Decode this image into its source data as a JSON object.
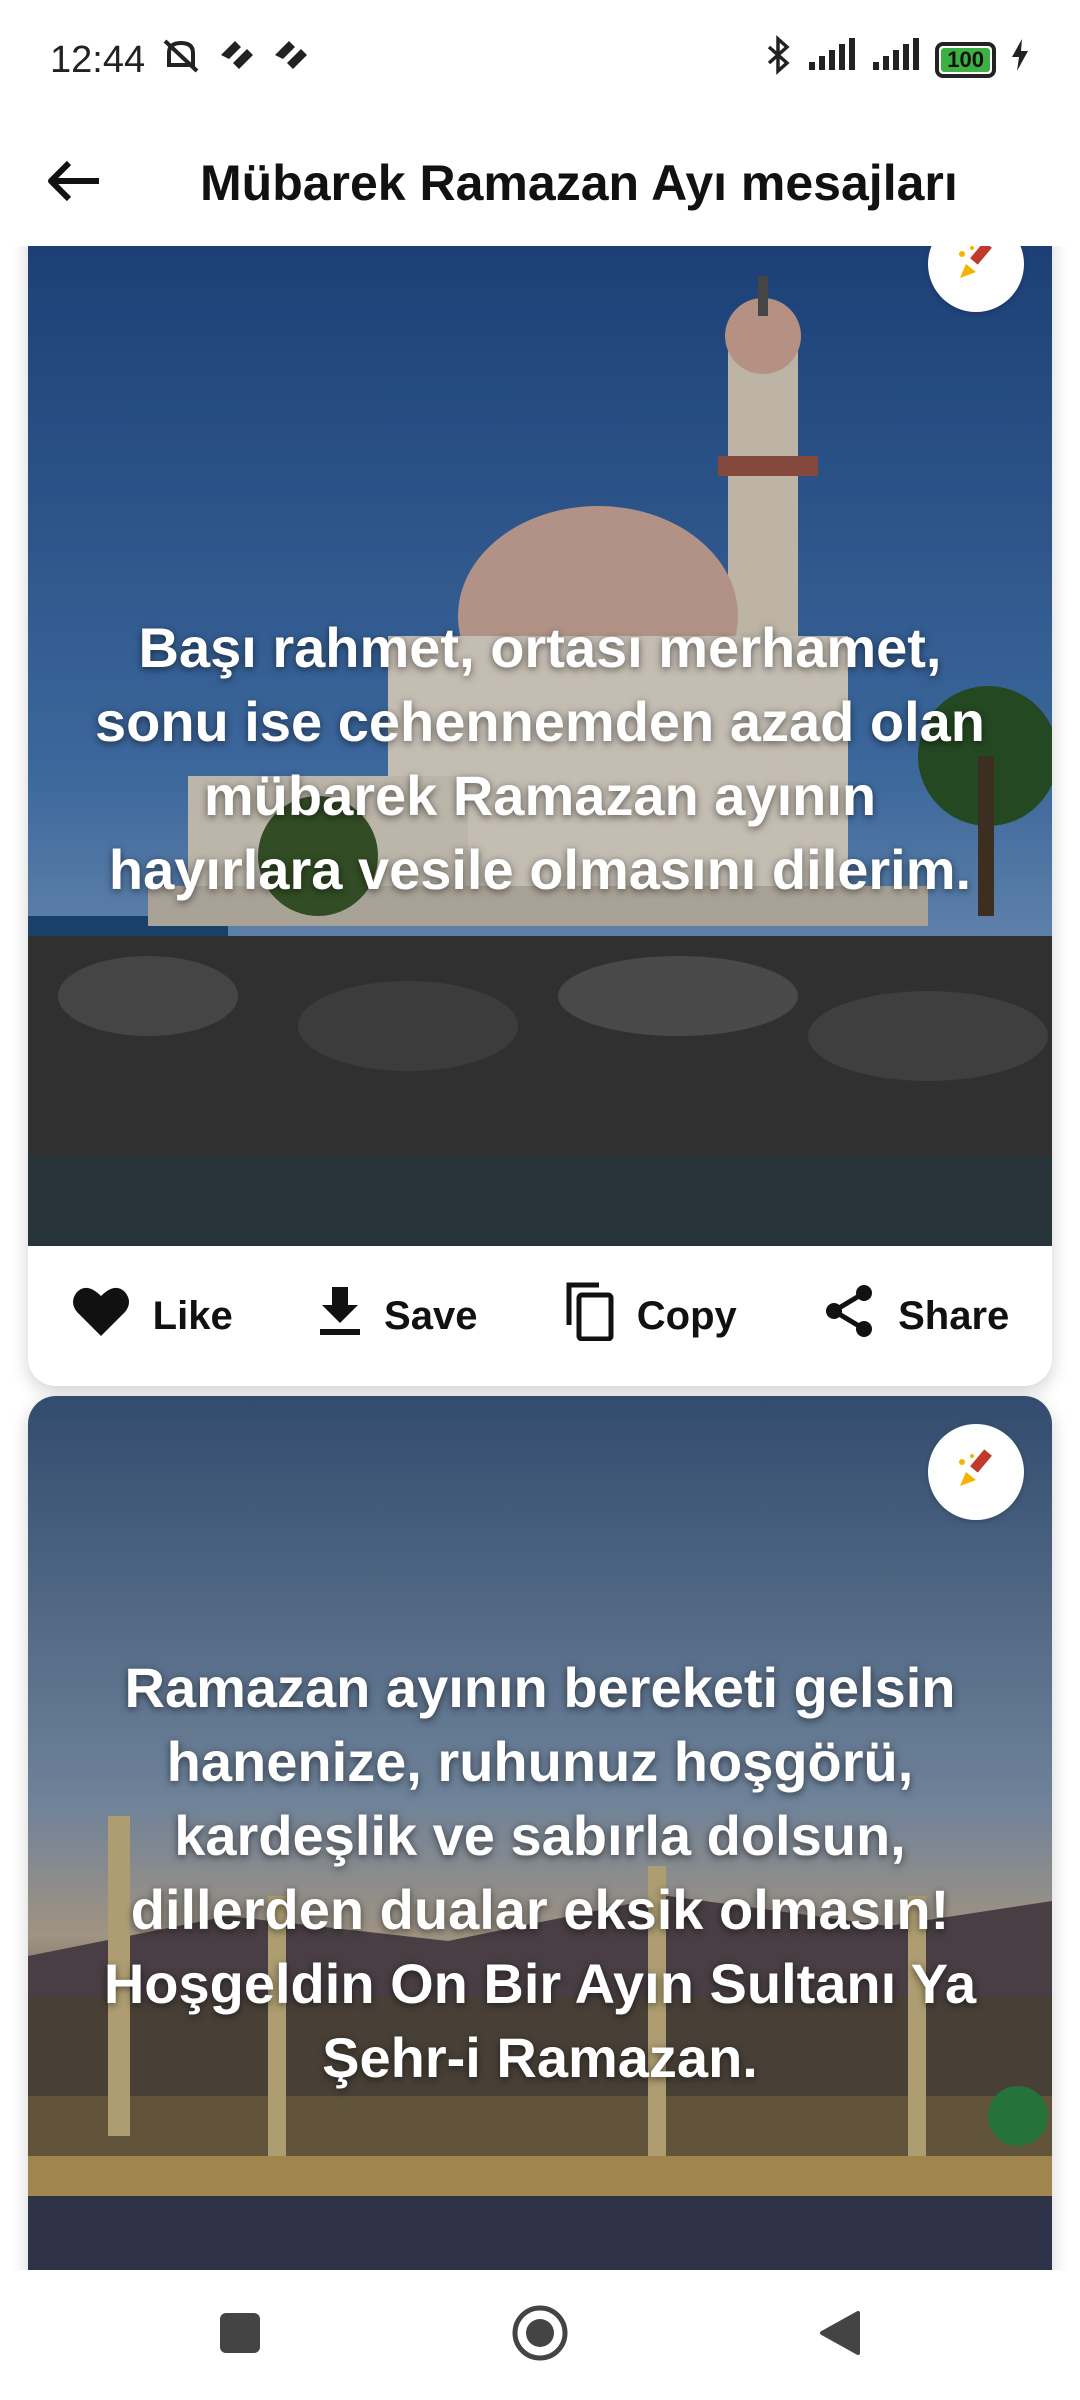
{
  "status_bar": {
    "time": "12:44",
    "battery": "100",
    "icons": [
      "mute-icon",
      "app-notification-icon",
      "app-notification-icon",
      "bluetooth-icon",
      "signal-icon",
      "signal-icon",
      "battery-icon",
      "charging-icon"
    ]
  },
  "app_bar": {
    "title": "Mübarek Ramazan Ayı mesajları",
    "back_icon": "arrow-back-icon"
  },
  "cards": [
    {
      "text": "Başı rahmet, ortası merhamet, sonu ise cehennemden azad olan mübarek Ramazan ayının hayırlara vesile olmasını dilerim.",
      "edit_icon": "brush-icon"
    },
    {
      "text": "Ramazan ayının bereketi gelsin hanenize, ruhunuz hoşgörü, kardeşlik ve sabırla dolsun, dillerden dualar eksik olmasın! Hoşgeldin On Bir Ayın Sultanı Ya Şehr-i Ramazan.",
      "edit_icon": "brush-icon"
    }
  ],
  "actions": {
    "like": "Like",
    "save": "Save",
    "copy": "Copy",
    "share": "Share"
  },
  "colors": {
    "accent_battery": "#3cb043",
    "text": "#111111",
    "card_bg": "#ffffff"
  }
}
